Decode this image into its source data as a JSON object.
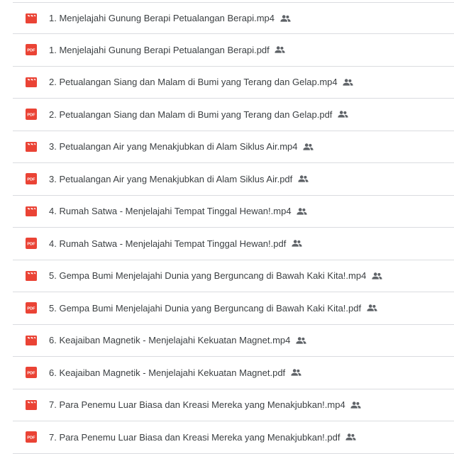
{
  "colors": {
    "video_icon": "#ea4335",
    "pdf_icon": "#ea4335",
    "text": "#3c4043",
    "shared_icon": "#5f6368",
    "divider": "#dadce0"
  },
  "files": [
    {
      "type": "video-icon",
      "name": "1. Menjelajahi Gunung Berapi Petualangan Berapi.mp4",
      "shared": "people-icon"
    },
    {
      "type": "pdf-icon",
      "icon_text": "PDF",
      "name": "1. Menjelajahi Gunung Berapi Petualangan Berapi.pdf",
      "shared": "people-icon"
    },
    {
      "type": "video-icon",
      "name": "2. Petualangan Siang dan Malam di Bumi yang Terang dan Gelap.mp4",
      "shared": "people-icon"
    },
    {
      "type": "pdf-icon",
      "icon_text": "PDF",
      "name": "2. Petualangan Siang dan Malam di Bumi yang Terang dan Gelap.pdf",
      "shared": "people-icon"
    },
    {
      "type": "video-icon",
      "name": "3. Petualangan Air yang Menakjubkan di Alam Siklus Air.mp4",
      "shared": "people-icon"
    },
    {
      "type": "pdf-icon",
      "icon_text": "PDF",
      "name": "3. Petualangan Air yang Menakjubkan di Alam Siklus Air.pdf",
      "shared": "people-icon"
    },
    {
      "type": "video-icon",
      "name": "4. Rumah Satwa - Menjelajahi Tempat Tinggal Hewan!.mp4",
      "shared": "people-icon"
    },
    {
      "type": "pdf-icon",
      "icon_text": "PDF",
      "name": "4. Rumah Satwa - Menjelajahi Tempat Tinggal Hewan!.pdf",
      "shared": "people-icon"
    },
    {
      "type": "video-icon",
      "name": "5. Gempa Bumi Menjelajahi Dunia yang Berguncang di Bawah Kaki Kita!.mp4",
      "shared": "people-icon"
    },
    {
      "type": "pdf-icon",
      "icon_text": "PDF",
      "name": "5. Gempa Bumi Menjelajahi Dunia yang Berguncang di Bawah Kaki Kita!.pdf",
      "shared": "people-icon"
    },
    {
      "type": "video-icon",
      "name": "6. Keajaiban Magnetik - Menjelajahi Kekuatan Magnet.mp4",
      "shared": "people-icon"
    },
    {
      "type": "pdf-icon",
      "icon_text": "PDF",
      "name": "6. Keajaiban Magnetik - Menjelajahi Kekuatan Magnet.pdf",
      "shared": "people-icon"
    },
    {
      "type": "video-icon",
      "name": "7. Para Penemu Luar Biasa dan Kreasi Mereka yang Menakjubkan!.mp4",
      "shared": "people-icon"
    },
    {
      "type": "pdf-icon",
      "icon_text": "PDF",
      "name": "7. Para Penemu Luar Biasa dan Kreasi Mereka yang Menakjubkan!.pdf",
      "shared": "people-icon"
    }
  ]
}
